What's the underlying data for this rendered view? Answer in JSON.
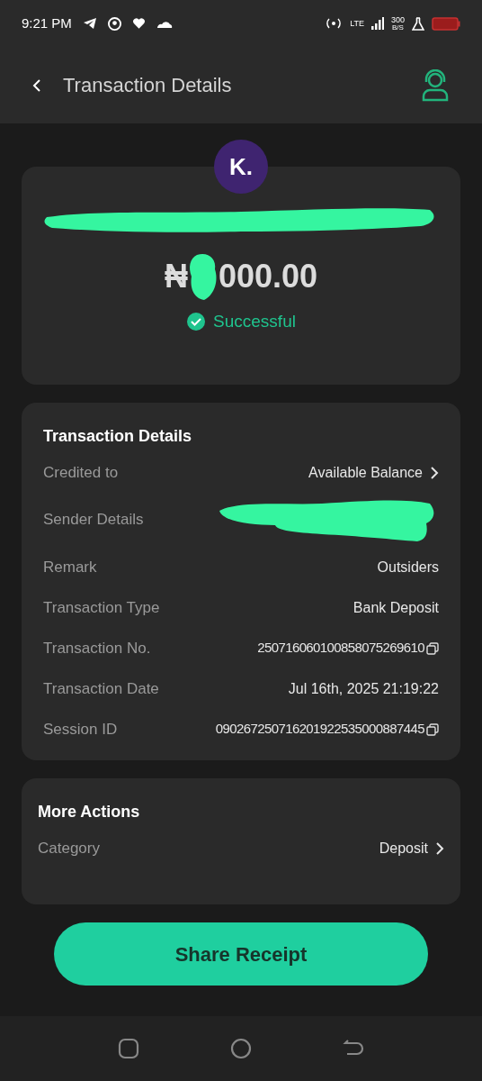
{
  "status_bar": {
    "time": "9:21 PM",
    "network": "LTE",
    "speed": "300",
    "speed_unit": "B/S"
  },
  "header": {
    "title": "Transaction Details"
  },
  "summary": {
    "logo_text": "K.",
    "amount_prefix": "₦",
    "amount_suffix": "000.00",
    "status": "Successful"
  },
  "details": {
    "title": "Transaction Details",
    "rows": [
      {
        "kind": "link",
        "label": "Credited to",
        "value": "Available Balance"
      },
      {
        "kind": "redacted",
        "label": "Sender Details"
      },
      {
        "kind": "text",
        "label": "Remark",
        "value": "Outsiders"
      },
      {
        "kind": "text",
        "label": "Transaction Type",
        "value": "Bank Deposit"
      },
      {
        "kind": "copy",
        "label": "Transaction No.",
        "value": "250716060100858075269610"
      },
      {
        "kind": "text",
        "label": "Transaction Date",
        "value": "Jul 16th, 2025 21:19:22"
      },
      {
        "kind": "copy",
        "label": "Session ID",
        "value": "090267250716201922535000887445"
      }
    ]
  },
  "more_actions": {
    "title": "More Actions",
    "rows": [
      {
        "kind": "link",
        "label": "Category",
        "value": "Deposit"
      }
    ]
  },
  "share_button": "Share Receipt"
}
